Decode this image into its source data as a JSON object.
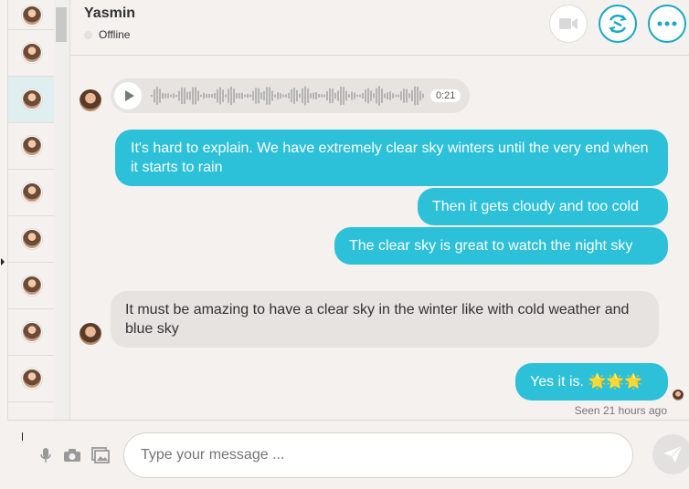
{
  "header": {
    "name": "Yasmin",
    "status": "Offline",
    "buttons": [
      "video-call-icon",
      "swap-icon",
      "more-icon"
    ]
  },
  "contacts": [
    {
      "id": 1,
      "active": false
    },
    {
      "id": 2,
      "active": false
    },
    {
      "id": 3,
      "active": true
    },
    {
      "id": 4,
      "active": false
    },
    {
      "id": 5,
      "active": false
    },
    {
      "id": 6,
      "active": false
    },
    {
      "id": 7,
      "active": false
    },
    {
      "id": 8,
      "active": false
    },
    {
      "id": 9,
      "active": false
    }
  ],
  "messages": {
    "voice": {
      "duration": "0:21"
    },
    "out1": "It's hard to explain. We have extremely clear sky winters until the very end when it starts to rain",
    "out2": "Then it gets cloudy and too cold",
    "out3": "The clear sky is great to watch the night sky",
    "in1": "It must be amazing to have a clear sky in the winter like with cold weather and blue sky",
    "out4": "Yes it is. 🌟🌟🌟",
    "seen": "Seen 21 hours ago"
  },
  "composer": {
    "placeholder": "Type your message ..."
  },
  "colors": {
    "accent": "#2cc0d9",
    "incoming": "#e6e3e0",
    "background": "#f4f1ee"
  }
}
